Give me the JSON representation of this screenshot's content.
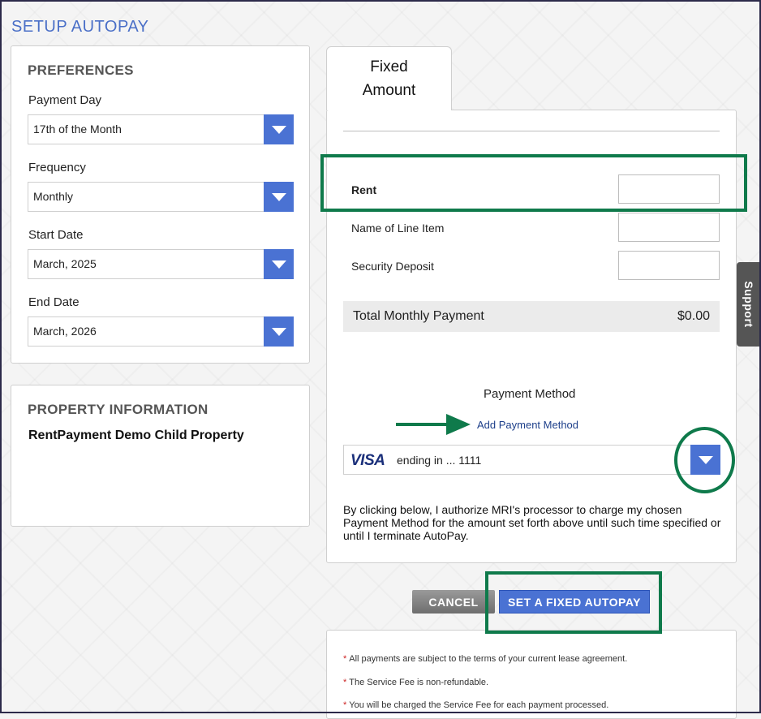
{
  "page_title": "SETUP AUTOPAY",
  "preferences": {
    "heading": "PREFERENCES",
    "fields": [
      {
        "label": "Payment Day",
        "value": "17th of the Month"
      },
      {
        "label": "Frequency",
        "value": "Monthly"
      },
      {
        "label": "Start Date",
        "value": "March, 2025"
      },
      {
        "label": "End Date",
        "value": "March, 2026"
      }
    ]
  },
  "property_info": {
    "heading": "PROPERTY INFORMATION",
    "name": "RentPayment Demo Child Property"
  },
  "tab": {
    "line1": "Fixed",
    "line2": "Amount"
  },
  "line_items": [
    {
      "label": "Rent",
      "value": ""
    },
    {
      "label": "Name of Line Item",
      "value": ""
    },
    {
      "label": "Security Deposit",
      "value": ""
    }
  ],
  "total": {
    "label": "Total Monthly Payment",
    "amount": "$0.00"
  },
  "payment_method": {
    "title": "Payment Method",
    "add_link": "Add Payment Method",
    "card_brand": "VISA",
    "card_text": "ending in ... 1111"
  },
  "authorization": "By clicking below, I authorize MRI's processor to charge my chosen Payment Method for the amount set forth above until such time specified or until I terminate AutoPay.",
  "buttons": {
    "cancel": "CANCEL",
    "set": "SET A FIXED AUTOPAY"
  },
  "notes": [
    "All payments are subject to the terms of your current lease agreement.",
    "The Service Fee is non-refundable.",
    "You will be charged the Service Fee for each payment processed."
  ],
  "support_tab": "Support",
  "colors": {
    "accent": "#4a72d3",
    "highlight": "#0f7a4b",
    "title": "#4a6fc7"
  }
}
